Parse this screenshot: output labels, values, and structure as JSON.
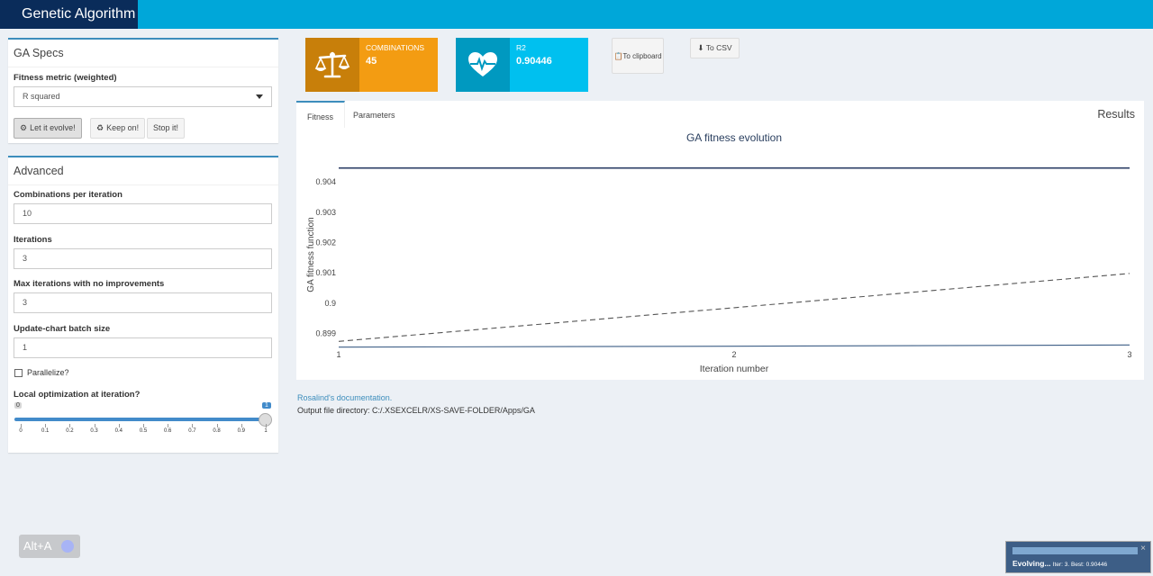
{
  "app": {
    "title": "Genetic Algorithm"
  },
  "ga_specs": {
    "title": "GA Specs",
    "fitness_label": "Fitness metric (weighted)",
    "fitness_value": "R squared",
    "buttons": {
      "evolve": "Let it evolve!",
      "keep": "Keep on!",
      "stop": "Stop it!"
    }
  },
  "advanced": {
    "title": "Advanced",
    "combinations_label": "Combinations per iteration",
    "combinations_value": "10",
    "iterations_label": "Iterations",
    "iterations_value": "3",
    "max_no_improve_label": "Max iterations with no improvements",
    "max_no_improve_value": "3",
    "batch_label": "Update-chart batch size",
    "batch_value": "1",
    "parallelize_label": "Parallelize?",
    "parallelize_checked": false,
    "local_opt_label": "Local optimization at iteration?",
    "slider": {
      "min_label": "0",
      "value_label": "1",
      "value": 1,
      "ticks": [
        "0",
        "0.1",
        "0.2",
        "0.3",
        "0.4",
        "0.5",
        "0.6",
        "0.7",
        "0.8",
        "0.9",
        "1"
      ]
    }
  },
  "value_boxes": [
    {
      "title": "COMBINATIONS",
      "value": "45",
      "icon": "balance-scale-icon",
      "color": "#f39c12",
      "icon_bg": "#c87f0a"
    },
    {
      "title": "R2",
      "value": "0.90446",
      "icon": "heartbeat-icon",
      "color": "#00c0ef",
      "icon_bg": "#0099c0"
    }
  ],
  "export": {
    "clipboard": "To clipboard",
    "csv": "To CSV"
  },
  "tabs": {
    "fitness": "Fitness",
    "parameters": "Parameters",
    "results_title": "Results"
  },
  "chart_data": {
    "type": "line",
    "title": "GA fitness evolution",
    "xlabel": "Iteration number",
    "ylabel": "GA fitness function",
    "x": [
      1,
      2,
      3
    ],
    "x_ticks": [
      "1",
      "2",
      "3"
    ],
    "y_ticks": [
      "0.899",
      "0.9",
      "0.901",
      "0.902",
      "0.903",
      "0.904"
    ],
    "ylim": [
      0.8986,
      0.9046
    ],
    "grid": false,
    "series": [
      {
        "values": [
          0.90446,
          0.90446,
          0.90446
        ],
        "style": "solid",
        "color": "#2c3e66"
      },
      {
        "values": [
          0.89874,
          0.89985,
          0.90098
        ],
        "style": "dashed",
        "color": "#555555"
      },
      {
        "values": [
          0.89855,
          0.89858,
          0.89862
        ],
        "style": "solid",
        "color": "#3d5e86"
      }
    ]
  },
  "footer": {
    "doc_link": "Rosalind's documentation.",
    "output_dir": "Output file directory: C:/.XSEXCELR/XS-SAVE-FOLDER/Apps/GA"
  },
  "overlay": {
    "alt_label": "Alt+A"
  },
  "notification": {
    "title": "Evolving...",
    "detail": "Iter: 3. Best: 0.90446",
    "close": "×"
  }
}
